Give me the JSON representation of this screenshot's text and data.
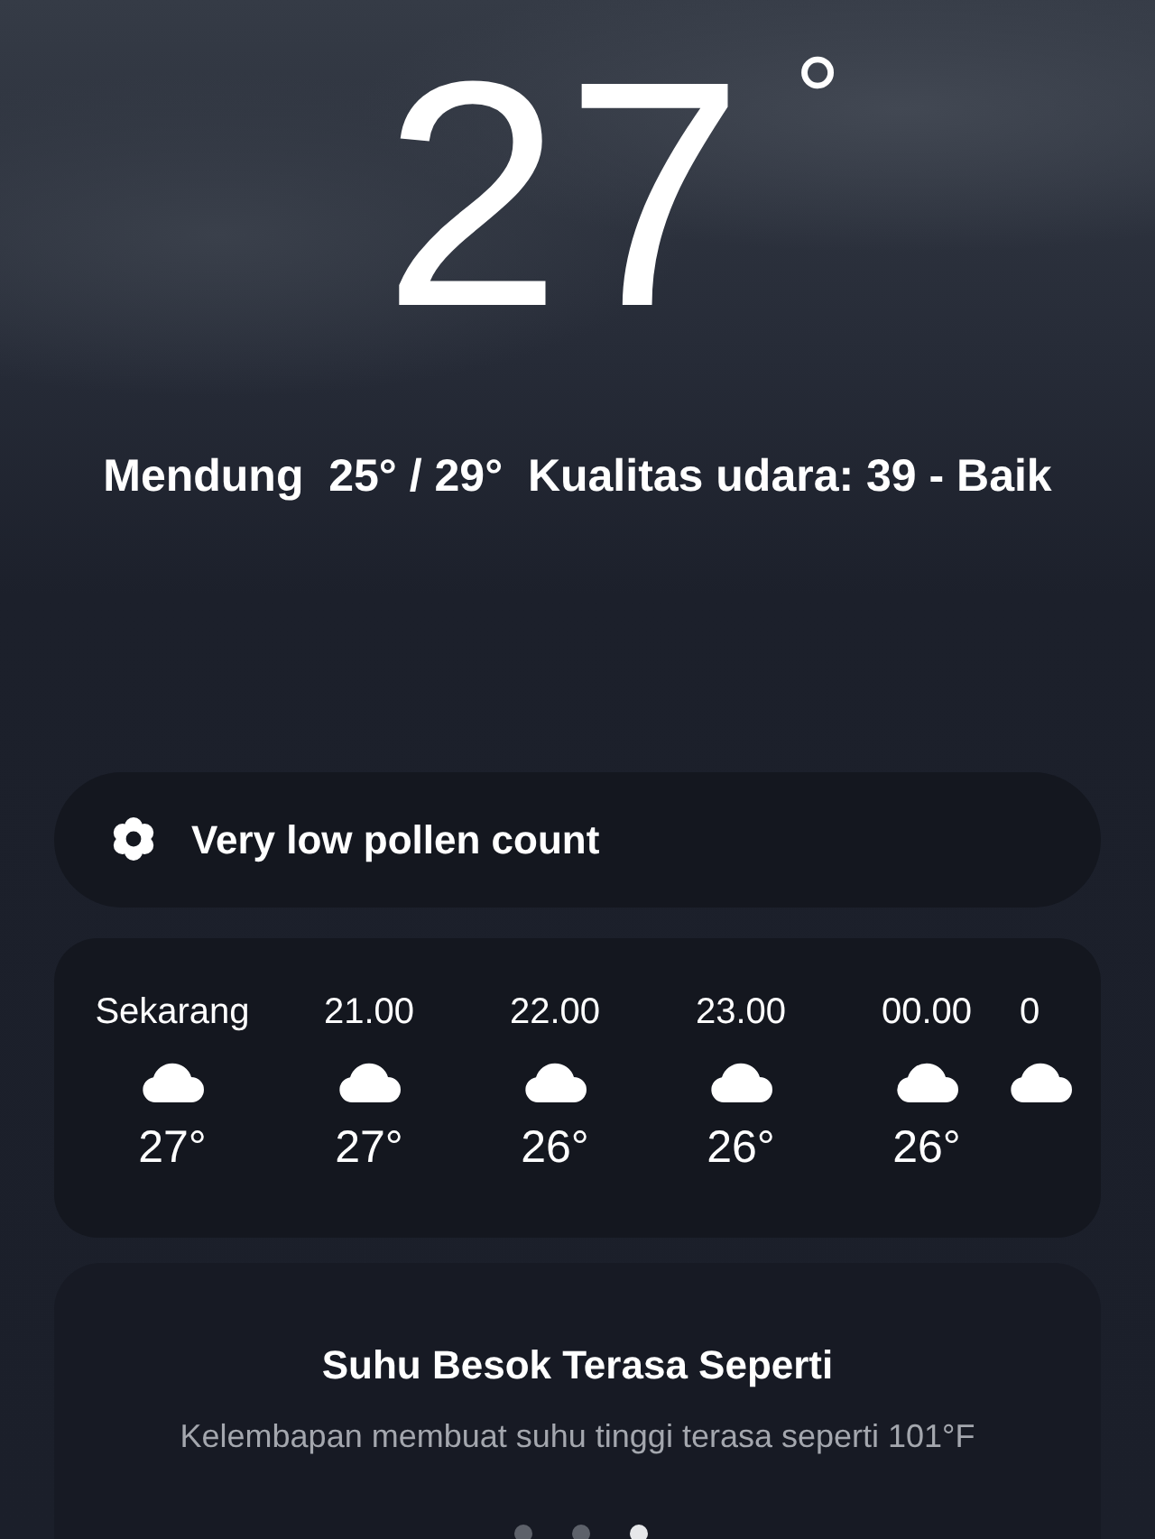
{
  "current": {
    "temperature": "27",
    "unit": "°",
    "summary": "Mendung  25° / 29°  Kualitas udara: 39 - Baik"
  },
  "pollen": {
    "label": "Very low pollen count"
  },
  "hourly": [
    {
      "time": "Sekarang",
      "kind": "cloudy",
      "temp": "27°"
    },
    {
      "time": "21.00",
      "kind": "cloudy",
      "temp": "27°"
    },
    {
      "time": "22.00",
      "kind": "cloudy",
      "temp": "26°"
    },
    {
      "time": "23.00",
      "kind": "cloudy",
      "temp": "26°"
    },
    {
      "time": "00.00",
      "kind": "cloudy",
      "temp": "26°"
    },
    {
      "time": "0",
      "kind": "cloudy"
    }
  ],
  "feels_like": {
    "title": "Suhu Besok Terasa Seperti",
    "text": "Kelembapan membuat suhu tinggi terasa seperti 101°F"
  },
  "pages": [
    {
      "selected": false
    },
    {
      "selected": false
    },
    {
      "selected": true
    }
  ]
}
